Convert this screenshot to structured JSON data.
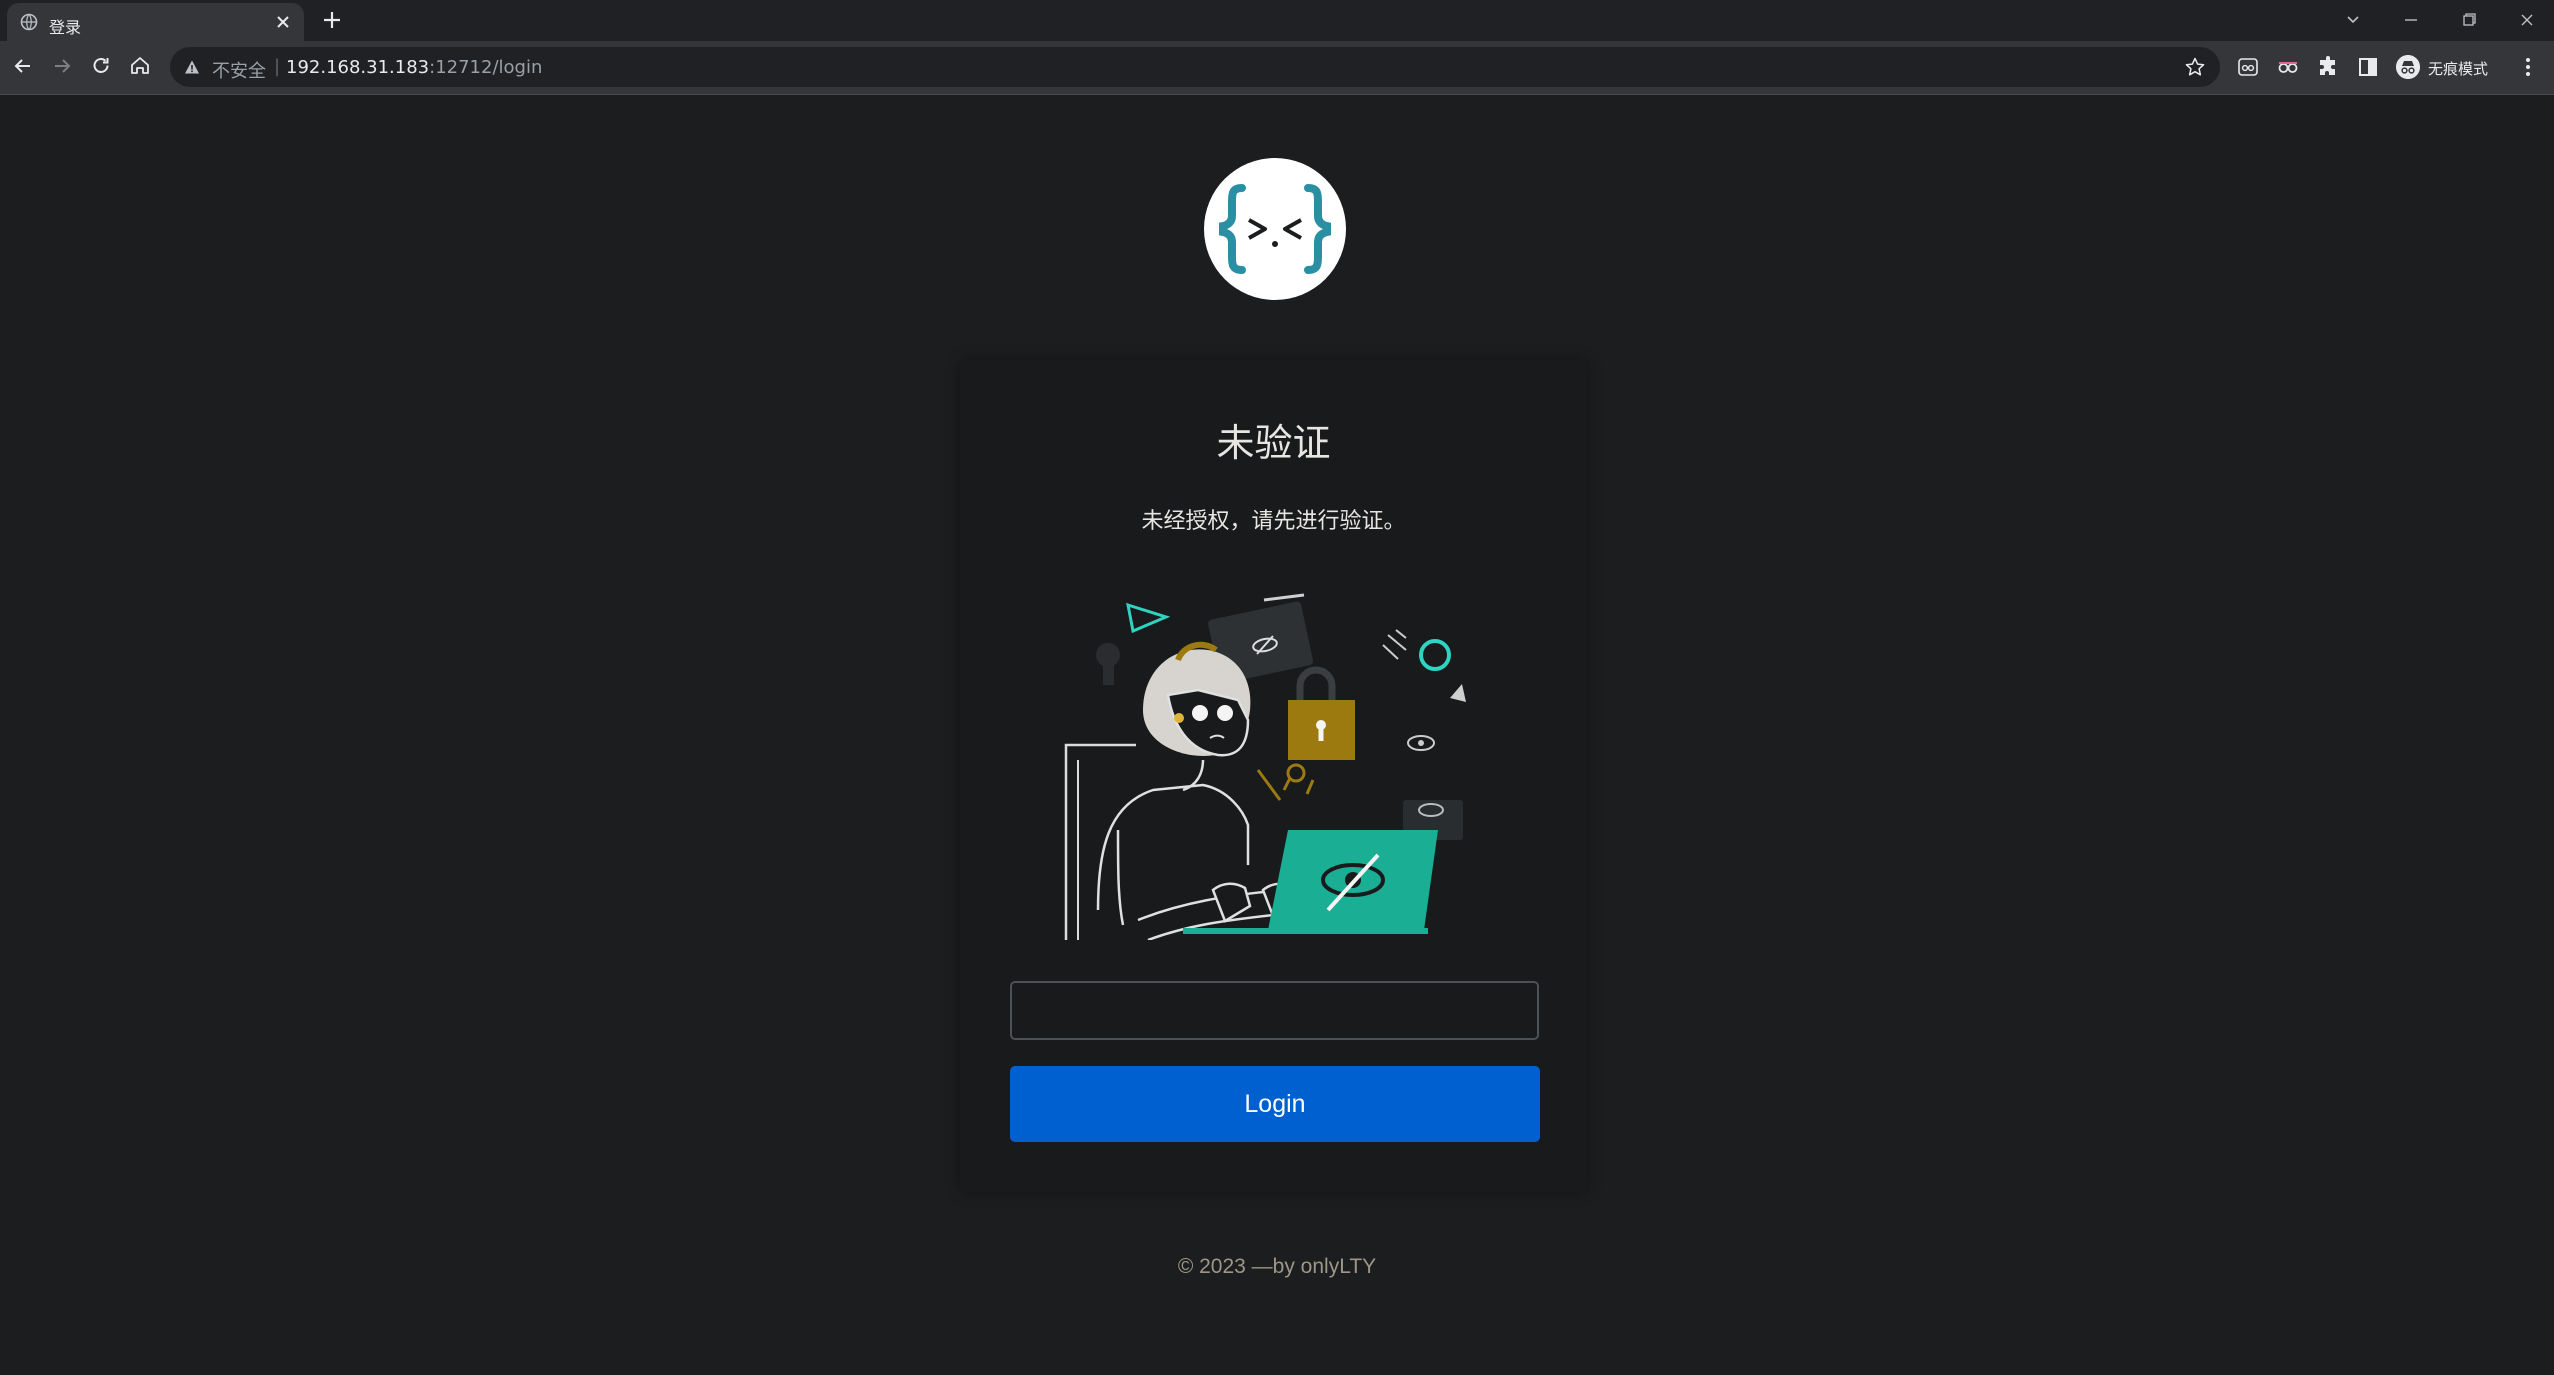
{
  "browser": {
    "tab_title": "登录",
    "url_security": "不安全",
    "url_host": "192.168.31.183",
    "url_path": ":12712/login",
    "incognito_label": "无痕模式",
    "icons": [
      "globe-icon",
      "close-icon",
      "plus-icon",
      "back-icon",
      "forward-icon",
      "reload-icon",
      "home-icon",
      "warning-icon",
      "star-icon",
      "extension-icon",
      "puzzle-icon",
      "sidepanel-icon",
      "incognito-icon",
      "kebab-menu-icon"
    ]
  },
  "page": {
    "logo_text": "{>.<}",
    "card_title": "未验证",
    "card_subtitle": "未经授权，请先进行验证。",
    "input_value": "",
    "login_button": "Login",
    "footer": "© 2023 —by onlyLTY"
  },
  "colors": {
    "page_bg": "#1b1d1e",
    "card_bg": "#181a1b",
    "button_bg": "#0060d0",
    "accent_teal": "#1aae94",
    "accent_gold": "#9c7a10",
    "logo_teal": "#2a8fa3"
  }
}
